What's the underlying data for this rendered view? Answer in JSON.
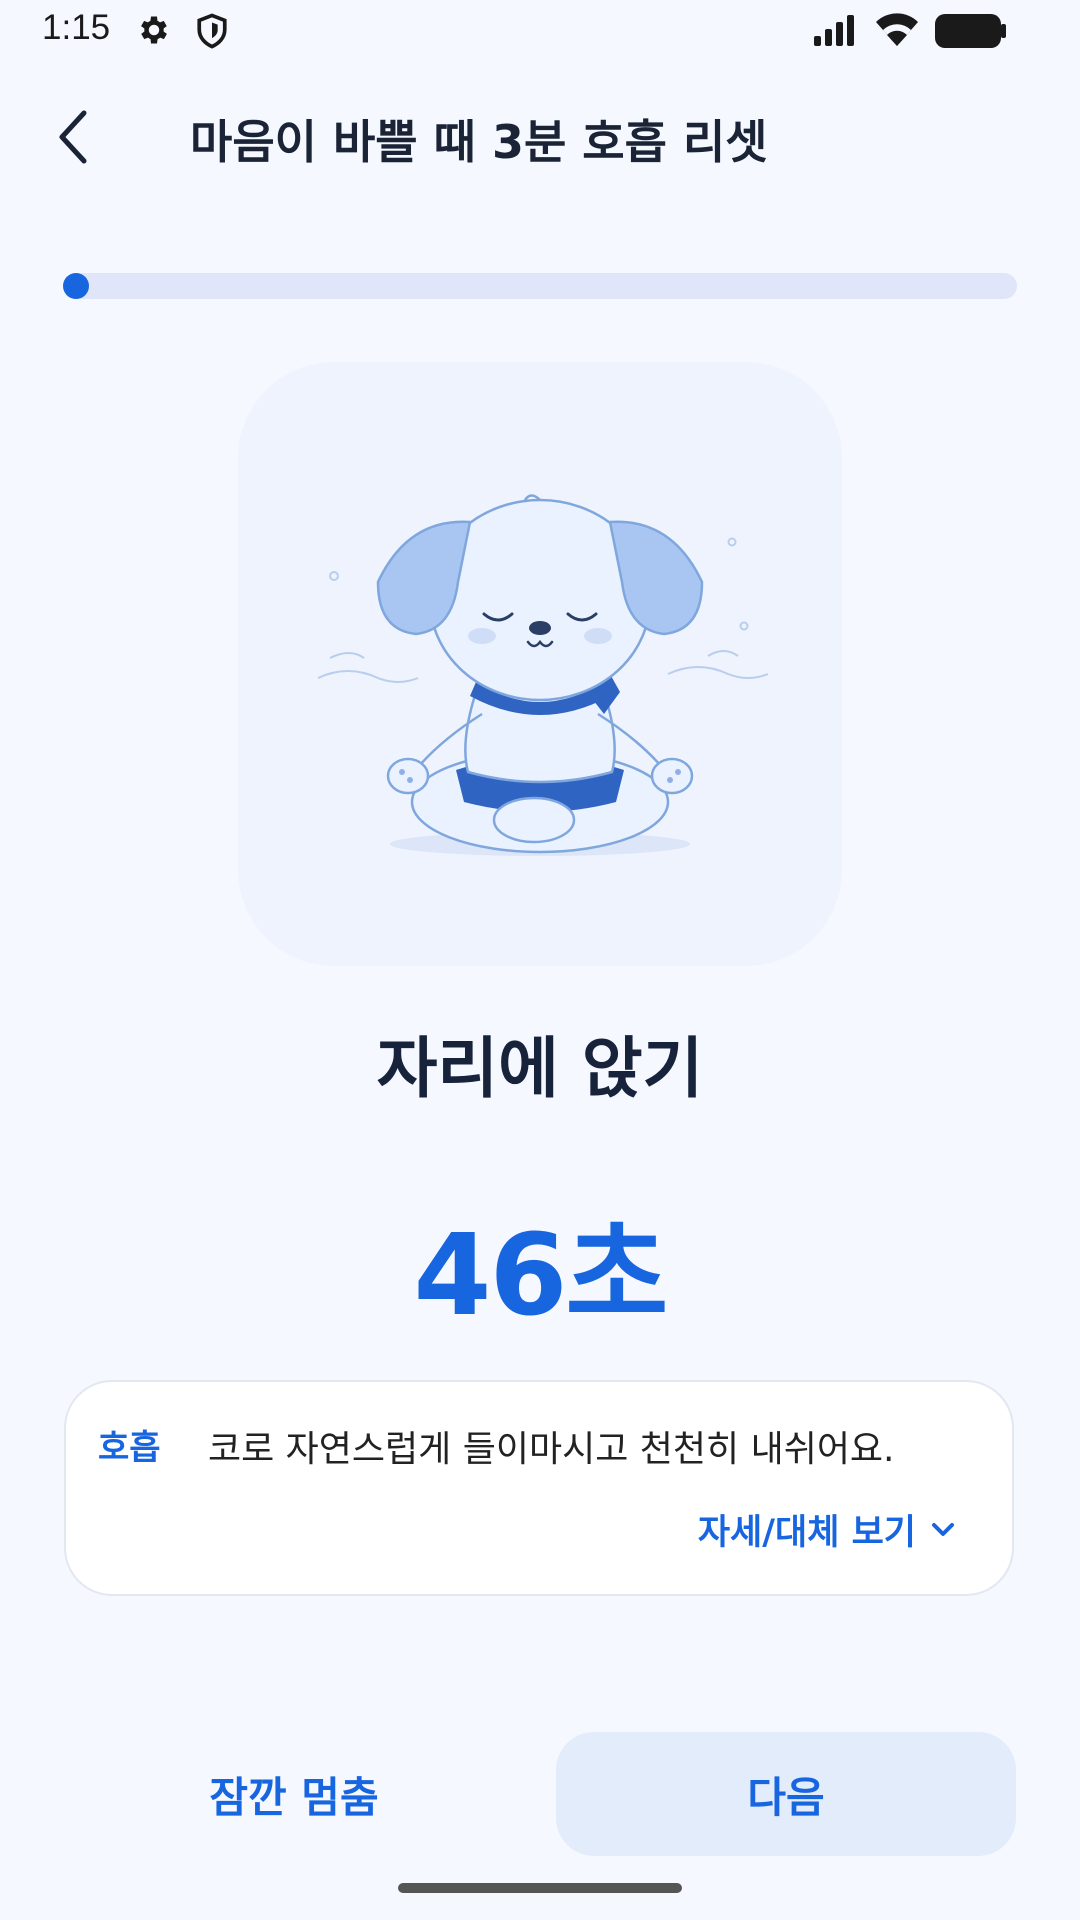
{
  "status_bar": {
    "time": "1:15",
    "icons": [
      "gear-icon",
      "shield-icon",
      "signal-icon",
      "wifi-icon",
      "battery-icon"
    ]
  },
  "header": {
    "back_icon": "back-arrow-icon",
    "title": "마음이 바쁠 때 3분 호흡 리셋"
  },
  "progress": {
    "fraction": 0.0
  },
  "illustration": {
    "subject": "meditating-puppy"
  },
  "step": {
    "title": "자리에 앉기",
    "timer": "46초"
  },
  "info": {
    "label": "호흡",
    "text": "코로 자연스럽게 들이마시고 천천히 내쉬어요.",
    "detail_label": "자세/대체 보기"
  },
  "buttons": {
    "pause_label": "잠깐 멈춤",
    "next_label": "다음"
  },
  "colors": {
    "accent": "#1766E0",
    "background": "#F5F8FE",
    "track": "#E0E5FA",
    "next_button_bg": "#E3ECFB"
  }
}
